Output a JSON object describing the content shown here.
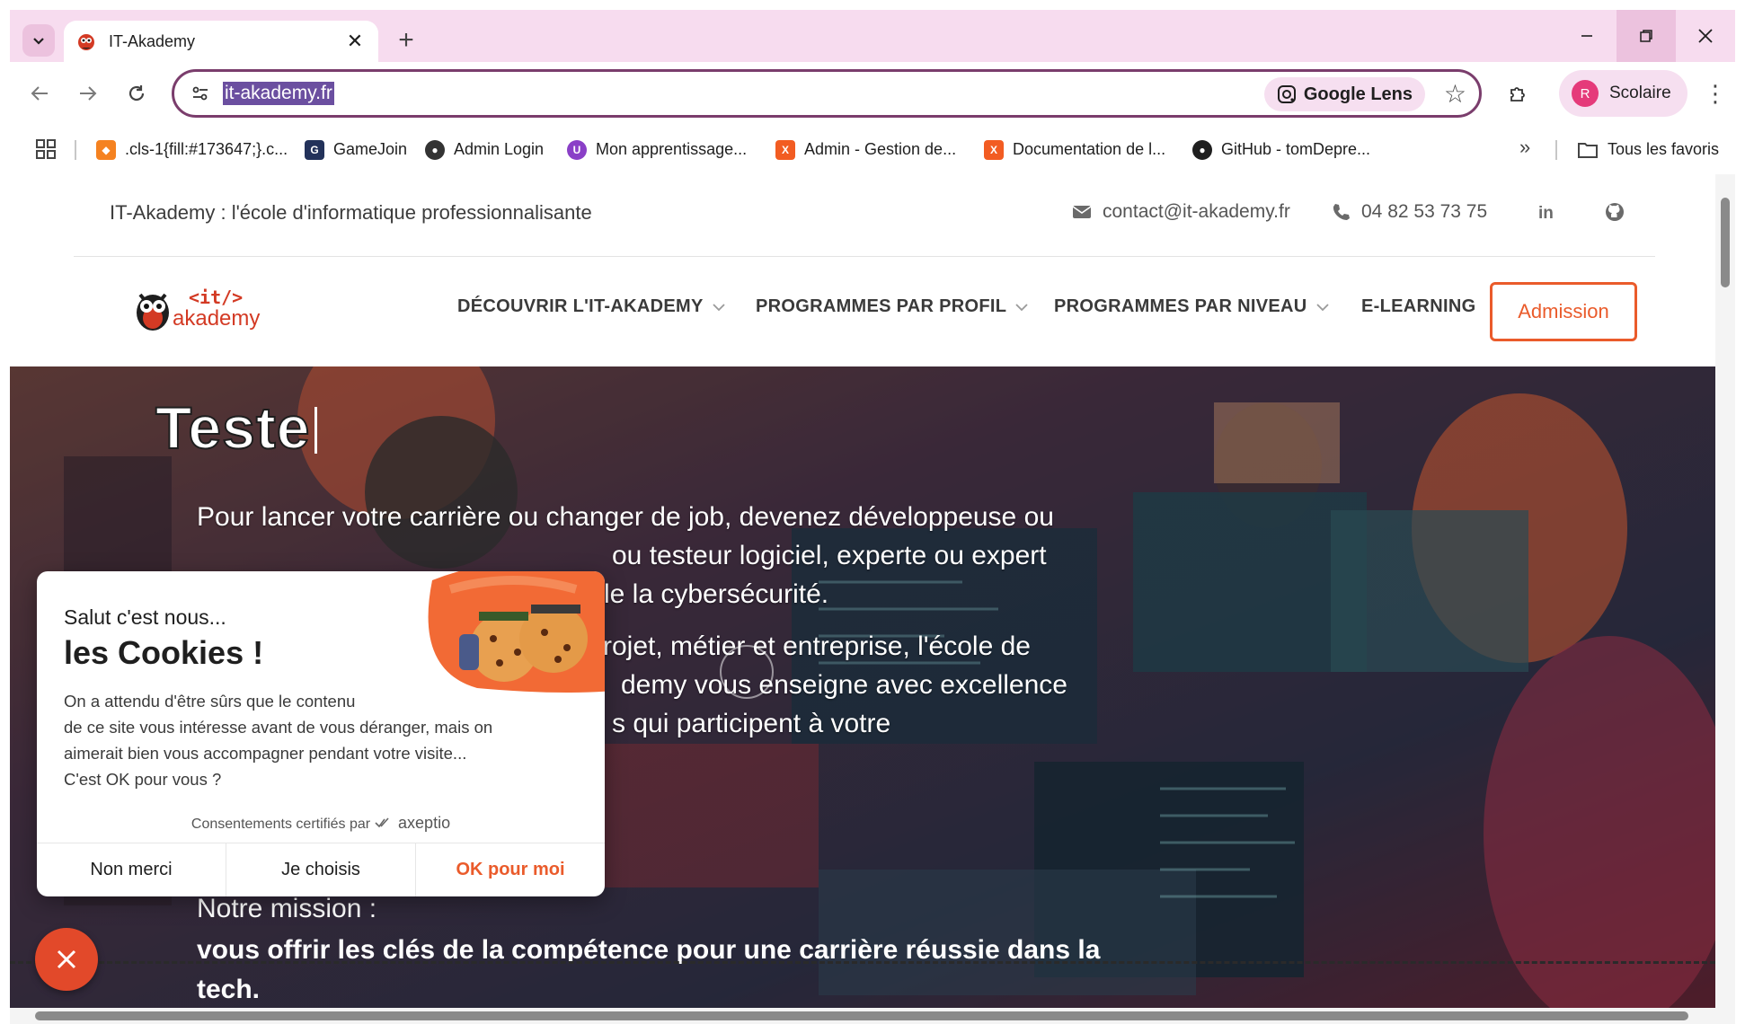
{
  "browser": {
    "tab_title": "IT-Akademy",
    "url": "it-akademy.fr",
    "lens_label": "Google Lens",
    "profile_initial": "R",
    "profile_label": "Scolaire",
    "bookmarks": [
      {
        "label": ".cls-1{fill:#173647;}.c..."
      },
      {
        "label": "GameJoin"
      },
      {
        "label": "Admin Login"
      },
      {
        "label": "Mon apprentissage..."
      },
      {
        "label": "Admin - Gestion de..."
      },
      {
        "label": "Documentation de l..."
      },
      {
        "label": "GitHub - tomDepre..."
      }
    ],
    "more_bookmarks": "»",
    "all_bookmarks": "Tous les favoris"
  },
  "site": {
    "tagline": "IT-Akademy : l'école d'informatique professionnalisante",
    "email": "contact@it-akademy.fr",
    "phone": "04 82 53 73 75",
    "logo_top": "<it/>",
    "logo_bottom": "akademy",
    "nav": [
      {
        "label": "DÉCOUVRIR L'IT-AKADEMY",
        "has_dropdown": true
      },
      {
        "label": "PROGRAMMES PAR PROFIL",
        "has_dropdown": true
      },
      {
        "label": "PROGRAMMES PAR NIVEAU",
        "has_dropdown": true
      },
      {
        "label": "E-LEARNING",
        "has_dropdown": false
      }
    ],
    "cta": "Admission"
  },
  "hero": {
    "title": "Teste",
    "para1": [
      "Pour lancer votre carrière ou changer de job, devenez développeuse ou",
      "ou testeur logiciel, experte ou expert",
      "le la cybersécurité."
    ],
    "para2": [
      "rojet, métier et entreprise, l'école de",
      "demy vous enseigne avec excellence",
      "s qui participent à votre"
    ],
    "mission_label": "Notre mission :",
    "mission_text": "vous offrir les clés de la compétence pour une carrière réussie dans la tech."
  },
  "cookie": {
    "greeting": "Salut c'est nous...",
    "title": "les Cookies !",
    "body": [
      "On a attendu d'être sûrs que le contenu",
      "de ce site vous intéresse avant de vous déranger, mais on",
      "aimerait bien vous accompagner pendant votre visite...",
      "C'est OK pour vous ?"
    ],
    "certified": "Consentements certifiés par",
    "brand": "axeptio",
    "buttons": {
      "refuse": "Non merci",
      "choose": "Je choisis",
      "accept": "OK pour moi"
    }
  },
  "colors": {
    "accent": "#ea5b2b",
    "chrome": "#f7dcef",
    "omnibox_border": "#7a3d6c"
  }
}
